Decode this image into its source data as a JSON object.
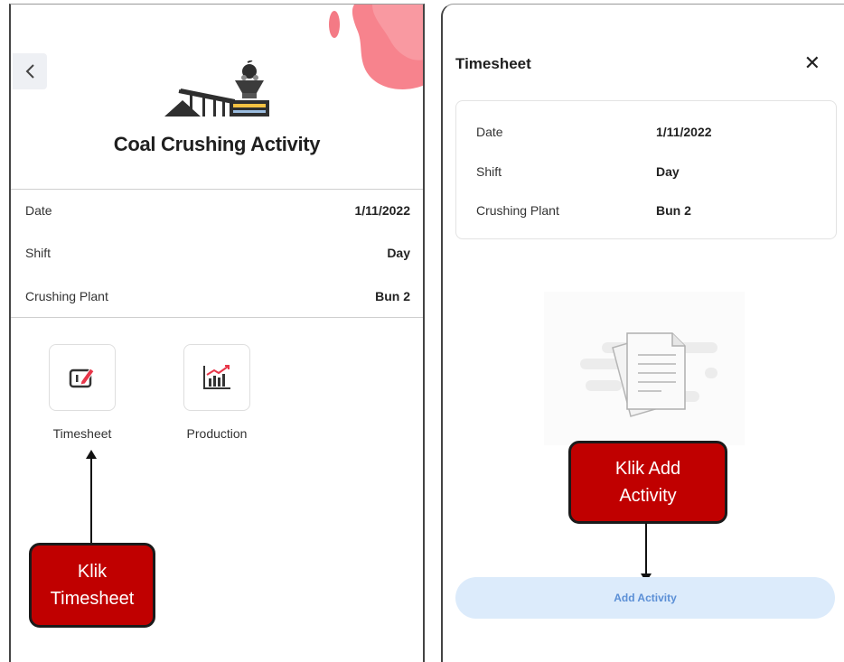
{
  "left_screen": {
    "back_icon": "chevron-left-icon",
    "title": "Coal Crushing Activity",
    "info": [
      {
        "label": "Date",
        "value": "1/11/2022"
      },
      {
        "label": "Shift",
        "value": "Day"
      },
      {
        "label": "Crushing Plant",
        "value": "Bun 2"
      }
    ],
    "menu": [
      {
        "label": "Timesheet",
        "icon": "timesheet-edit-icon"
      },
      {
        "label": "Production",
        "icon": "production-chart-icon"
      }
    ],
    "callout": {
      "line1": "Klik",
      "line2": "Timesheet"
    }
  },
  "right_screen": {
    "title": "Timesheet",
    "close_icon": "close-icon",
    "close_glyph": "✕",
    "info": [
      {
        "label": "Date",
        "value": "1/11/2022"
      },
      {
        "label": "Shift",
        "value": "Day"
      },
      {
        "label": "Crushing Plant",
        "value": "Bun 2"
      }
    ],
    "empty_illustration": "empty-documents-icon",
    "callout": {
      "line1": "Klik Add",
      "line2": "Activity"
    },
    "add_button_label": "Add Activity"
  },
  "colors": {
    "callout_red": "#c00000",
    "accent_blue_bg": "#dcebfb",
    "accent_blue_text": "#5b8fd6",
    "blob_pink": "#f47a85"
  }
}
